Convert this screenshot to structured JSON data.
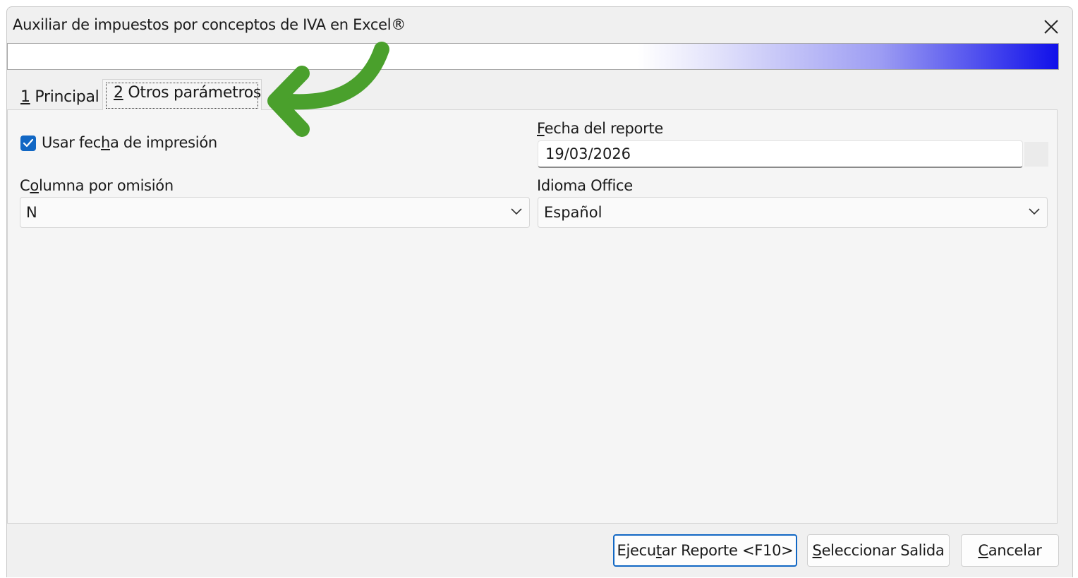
{
  "window": {
    "title": "Auxiliar de impuestos por conceptos de IVA en Excel®"
  },
  "tabs": [
    {
      "num": "1",
      "label": " Principal"
    },
    {
      "num": "2",
      "label": " Otros parámetros"
    }
  ],
  "form": {
    "use_print_date": {
      "pre": "Usar fec",
      "u": "h",
      "post": "a de impresión",
      "checked": true
    },
    "report_date": {
      "label_u": "F",
      "label_rest": "echa del reporte",
      "value": "19/03/2026"
    },
    "default_column": {
      "label_pre": "C",
      "label_u": "o",
      "label_post": "lumna por omisión",
      "value": "N"
    },
    "office_language": {
      "label": "Idioma Office",
      "value": "Español"
    }
  },
  "buttons": {
    "run": {
      "pre": "Ejecu",
      "u": "t",
      "post": "ar Reporte <F10>"
    },
    "output": {
      "u": "S",
      "post": "eleccionar Salida"
    },
    "cancel": {
      "u": "C",
      "post": "ancelar"
    }
  },
  "colors": {
    "accent": "#1167c4",
    "annotation_arrow": "#4aa02c",
    "banner_end": "#1010ea"
  },
  "icons": {
    "close": "close-icon",
    "checkbox": "checkmark-icon",
    "dropdown": "chevron-down-icon"
  }
}
